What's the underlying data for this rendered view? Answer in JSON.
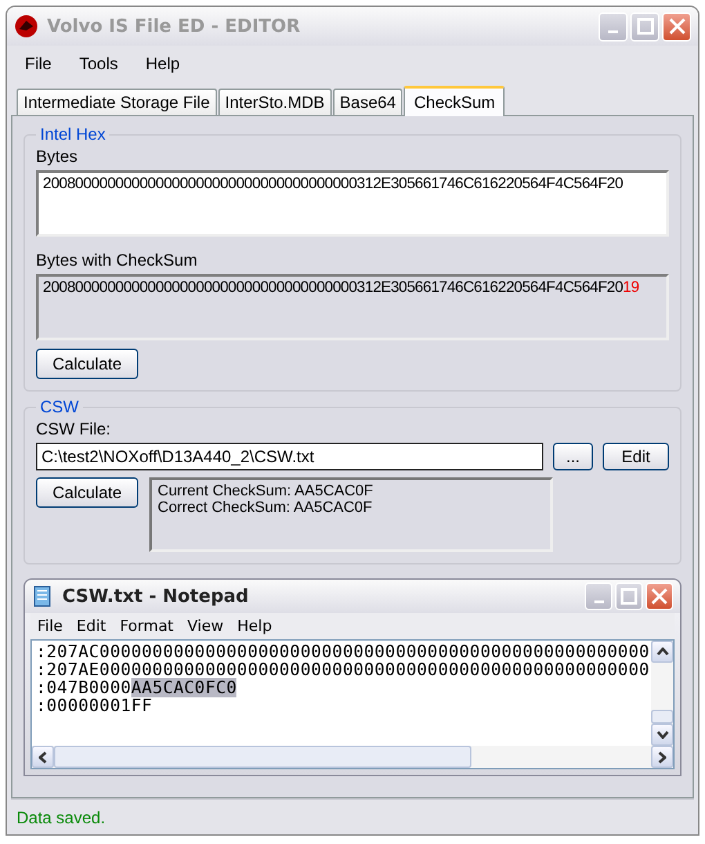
{
  "window": {
    "title": "Volvo IS File ED - EDITOR"
  },
  "menu": [
    "File",
    "Tools",
    "Help"
  ],
  "tabs": [
    {
      "label": "Intermediate Storage File",
      "selected": false
    },
    {
      "label": "InterSto.MDB",
      "selected": false
    },
    {
      "label": "Base64",
      "selected": false
    },
    {
      "label": "CheckSum",
      "selected": true
    }
  ],
  "intel_hex": {
    "title": "Intel Hex",
    "bytes_label": "Bytes",
    "bytes": "200800000000000000000000000000000000000312E305661746C616220564F4C564F20",
    "checksum_label": "Bytes with CheckSum",
    "checksum_bytes": "200800000000000000000000000000000000000312E305661746C616220564F4C564F20",
    "checksum": "19",
    "button": "Calculate"
  },
  "csw": {
    "title": "CSW",
    "file_label": "CSW File:",
    "file": "C:\\test2\\NOXoff\\D13A440_2\\CSW.txt",
    "browse_button": "...",
    "edit_button": "Edit",
    "calculate_button": "Calculate",
    "results": [
      "Current CheckSum: AA5CAC0F",
      "Correct CheckSum: AA5CAC0F"
    ]
  },
  "notepad": {
    "title": "CSW.txt - Notepad",
    "menu": [
      "File",
      "Edit",
      "Format",
      "View",
      "Help"
    ],
    "lines": [
      {
        "text": ":207AC0000000000000000000000000000000000000000000000000000"
      },
      {
        "text": ":207AE0000000000000000000000000000000000000000000000000000"
      },
      {
        "text": ":047B0000",
        "selection": "AA5CAC0FC0"
      },
      {
        "text": ":00000001FF"
      }
    ]
  },
  "status_bar": "Data saved."
}
